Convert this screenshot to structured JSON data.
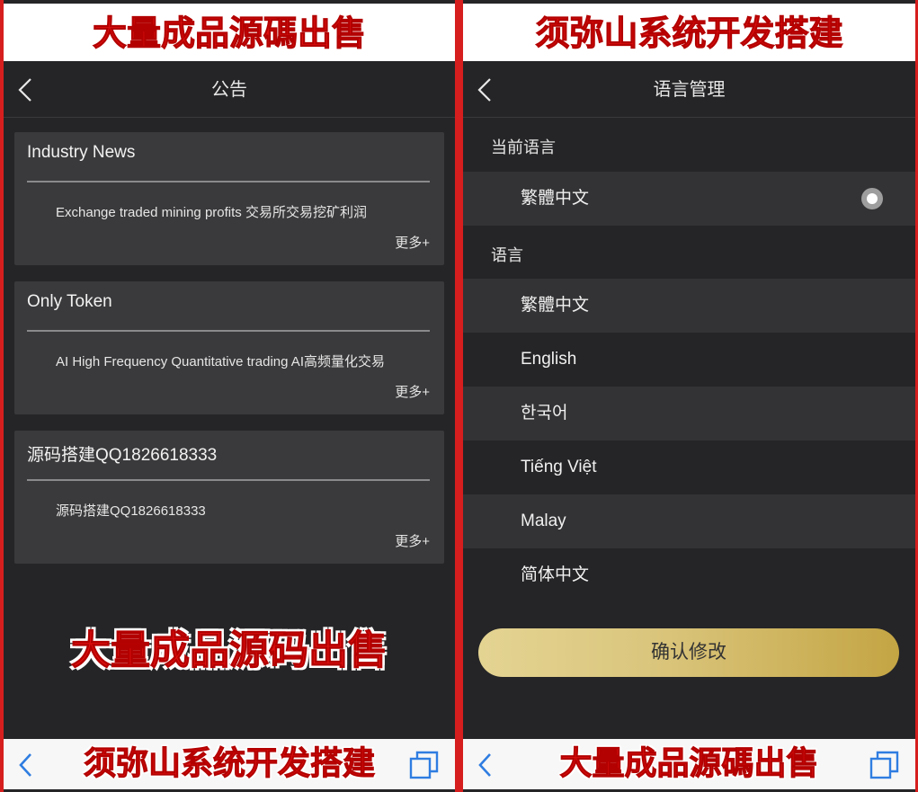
{
  "left": {
    "top_promo": "大量成品源碼出售",
    "nav_title": "公告",
    "announcements": [
      {
        "title": "Industry News",
        "body": "Exchange traded mining profits 交易所交易挖矿利润",
        "more": "更多+"
      },
      {
        "title": "Only Token",
        "body": "AI High Frequency Quantitative trading AI高频量化交易",
        "more": "更多+"
      },
      {
        "title": "源码搭建QQ1826618333",
        "body": "源码搭建QQ1826618333",
        "more": "更多+"
      }
    ],
    "mid_promo": "大量成品源码出售",
    "bottom_promo": "须弥山系统开发搭建"
  },
  "right": {
    "top_promo": "须弥山系统开发搭建",
    "nav_title": "语言管理",
    "current_label": "当前语言",
    "current_language": "繁體中文",
    "languages_label": "语言",
    "languages": [
      "繁體中文",
      "English",
      "한국어",
      "Tiếng Việt",
      "Malay",
      "简体中文"
    ],
    "confirm_button": "确认修改",
    "bottom_promo": "大量成品源碼出售"
  },
  "colors": {
    "frame": "#d61e1e",
    "background": "#252527",
    "card": "#3a3a3c",
    "gold_start": "#e4d493",
    "gold_end": "#c4a544",
    "promo_red": "#e01010"
  },
  "icons": [
    "chevron-left-icon",
    "radio-selected-icon",
    "browser-back-icon",
    "browser-tabs-icon"
  ]
}
